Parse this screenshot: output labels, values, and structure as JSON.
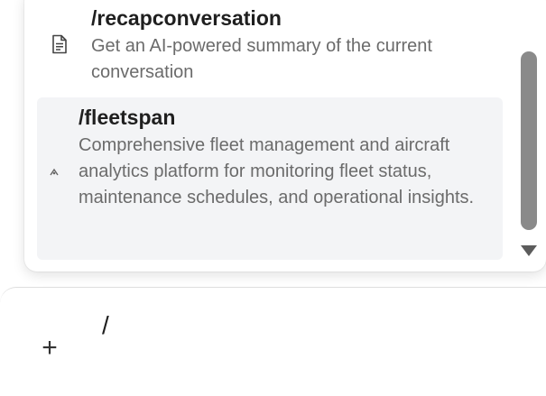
{
  "commands": [
    {
      "title": "/recapconversation",
      "description": "Get an AI-powered summary of the current conversation",
      "icon": "document-icon",
      "selected": false
    },
    {
      "title": "/fleetspan",
      "description": "Comprehensive fleet management and aircraft analytics platform for monitoring fleet status, maintenance schedules, and operational insights.",
      "icon": "app-icon",
      "selected": true
    }
  ],
  "composer": {
    "add_label": "+",
    "input_value": "/"
  },
  "colors": {
    "selected_bg": "#f3f4f6",
    "scrollbar_thumb": "#8a8a8a"
  }
}
